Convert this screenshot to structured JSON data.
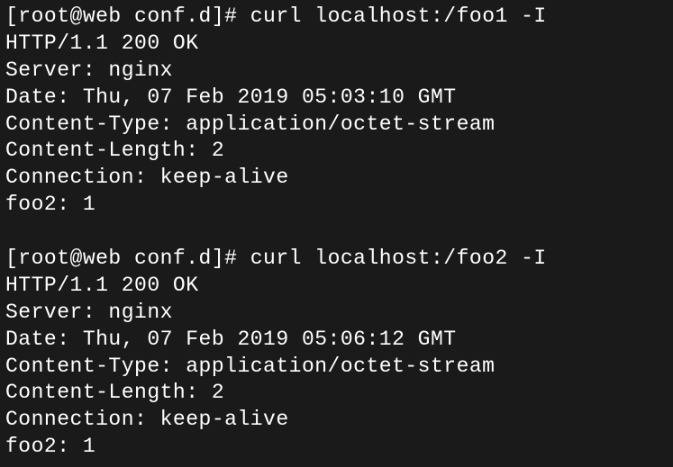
{
  "block1": {
    "prompt": "[root@web conf.d]# ",
    "command": "curl localhost:/foo1 -I",
    "status_line": "HTTP/1.1 200 OK",
    "server": "Server: nginx",
    "date": "Date: Thu, 07 Feb 2019 05:03:10 GMT",
    "content_type": "Content-Type: application/octet-stream",
    "content_length": "Content-Length: 2",
    "connection": "Connection: keep-alive",
    "custom_header": "foo2: 1"
  },
  "block2": {
    "prompt": "[root@web conf.d]# ",
    "command": "curl localhost:/foo2 -I",
    "status_line": "HTTP/1.1 200 OK",
    "server": "Server: nginx",
    "date": "Date: Thu, 07 Feb 2019 05:06:12 GMT",
    "content_type": "Content-Type: application/octet-stream",
    "content_length": "Content-Length: 2",
    "connection": "Connection: keep-alive",
    "custom_header": "foo2: 1"
  }
}
